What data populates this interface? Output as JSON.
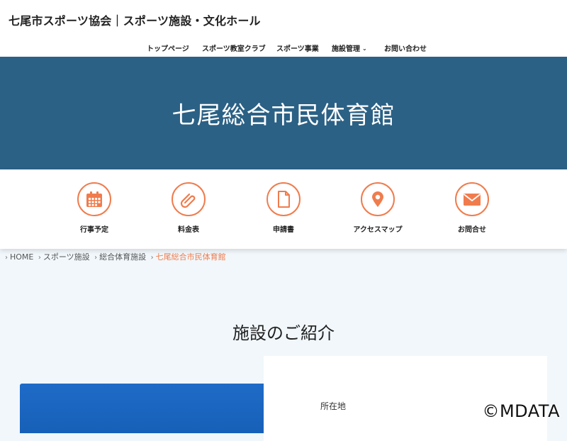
{
  "header": {
    "site_title": "七尾市スポーツ協会｜スポーツ施設・文化ホール"
  },
  "nav": {
    "items": [
      {
        "label": "トップページ"
      },
      {
        "label": "スポーツ教室クラブ"
      },
      {
        "label": "スポーツ事業"
      },
      {
        "label": "施設管理"
      },
      {
        "label": "お問い合わせ"
      }
    ]
  },
  "hero": {
    "title": "七尾総合市民体育館"
  },
  "quick_links": [
    {
      "label": "行事予定",
      "icon": "calendar-icon"
    },
    {
      "label": "料金表",
      "icon": "paperclip-icon"
    },
    {
      "label": "申請書",
      "icon": "document-icon"
    },
    {
      "label": "アクセスマップ",
      "icon": "map-pin-icon"
    },
    {
      "label": "お問合せ",
      "icon": "envelope-icon"
    }
  ],
  "breadcrumb": {
    "items": [
      {
        "label": "HOME"
      },
      {
        "label": "スポーツ施設"
      },
      {
        "label": "総合体育施設"
      }
    ],
    "current": "七尾総合市民体育館"
  },
  "section": {
    "title": "施設のご紹介"
  },
  "info": {
    "location_label": "所在地"
  },
  "watermark": "©MDATA",
  "colors": {
    "accent": "#f07c4d",
    "hero_bg": "#2b6185",
    "page_bg": "#f1f7fb"
  }
}
